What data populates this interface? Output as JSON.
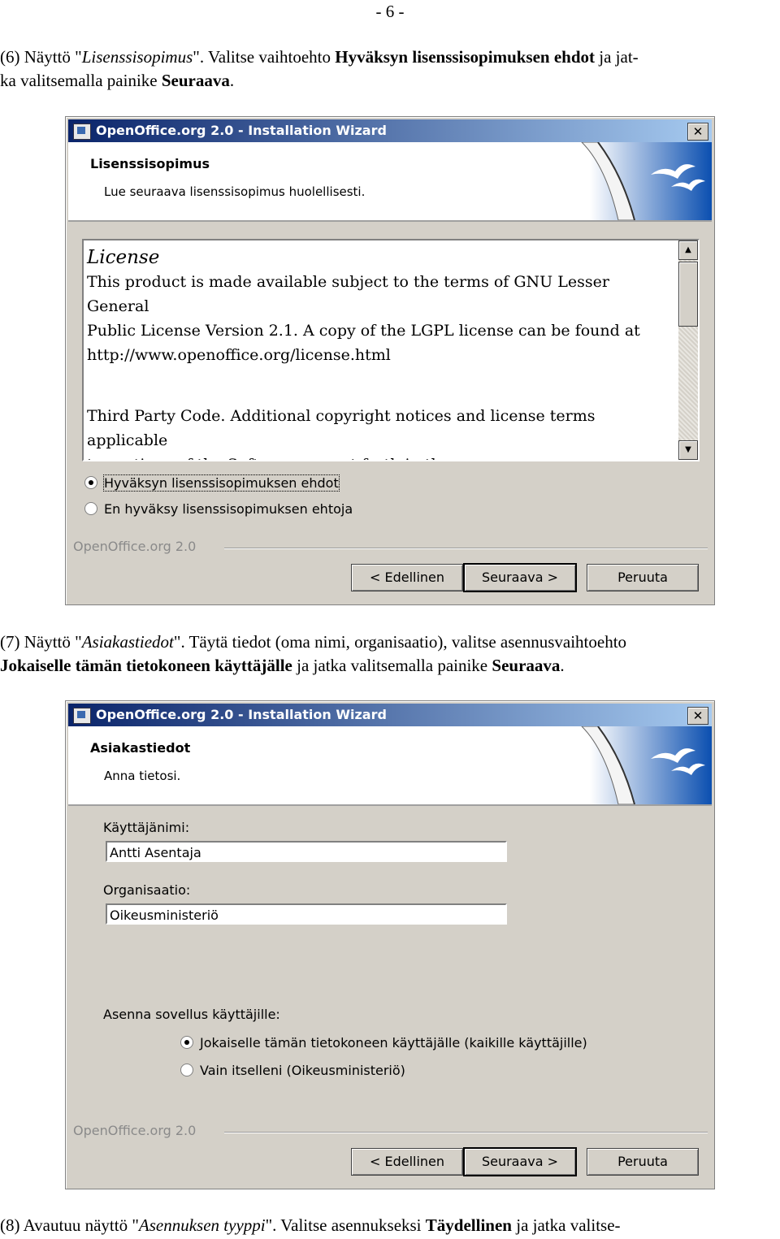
{
  "page_number": "- 6 -",
  "step6": {
    "prefix": "(6)  Näyttö \"",
    "screen": "Lisenssisopimus",
    "mid": "\". Valitse vaihtoehto ",
    "option": "Hyväksyn lisenssisopimuksen ehdot",
    "after": " ja jat-",
    "line2_pre": "ka valitsemalla painike ",
    "button": "Seuraava",
    "end": "."
  },
  "dialog1": {
    "title": "OpenOffice.org 2.0 - Installation Wizard",
    "header_title": "Lisenssisopimus",
    "header_subtitle": "Lue seuraava lisenssisopimus huolellisesti.",
    "license_heading": "License",
    "license_lines": [
      "This product is made available subject to the terms of GNU Lesser General",
      "Public License Version 2.1. A copy of the LGPL license can be found at",
      "http://www.openoffice.org/license.html"
    ],
    "license_lines2": [
      "Third Party Code. Additional copyright notices and license terms applicable",
      "to portions of the Software are set forth in the"
    ],
    "radio_accept": "Hyväksyn lisenssisopimuksen ehdot",
    "radio_decline": "En hyväksy lisenssisopimuksen ehtoja",
    "brand": "OpenOffice.org 2.0",
    "btn_back": "< Edellinen",
    "btn_next": "Seuraava >",
    "btn_cancel": "Peruuta"
  },
  "step7": {
    "prefix": "(7)  Näyttö \"",
    "screen": "Asiakastiedot",
    "mid": "\". Täytä tiedot (oma nimi, organisaatio), valitse asennusvaihtoehto",
    "option": "Jokaiselle tämän tietokoneen käyttäjälle",
    "after": " ja jatka valitsemalla painike ",
    "button": "Seuraava",
    "end": "."
  },
  "dialog2": {
    "title": "OpenOffice.org 2.0 - Installation Wizard",
    "header_title": "Asiakastiedot",
    "header_subtitle": "Anna tietosi.",
    "username_label": "Käyttäjänimi:",
    "username_value": "Antti Asentaja",
    "org_label": "Organisaatio:",
    "org_value": "Oikeusministeriö",
    "install_for_label": "Asenna sovellus käyttäjille:",
    "radio_all": "Jokaiselle tämän tietokoneen käyttäjälle (kaikille käyttäjille)",
    "radio_me": "Vain itselleni (Oikeusministeriö)",
    "brand": "OpenOffice.org 2.0",
    "btn_back": "< Edellinen",
    "btn_next": "Seuraava >",
    "btn_cancel": "Peruuta"
  },
  "step8": {
    "prefix": "(8)  Avautuu näyttö \"",
    "screen": "Asennuksen tyyppi",
    "mid": "\". Valitse asennukseksi ",
    "option": "Täydellinen",
    "after": " ja jatka valitse-"
  }
}
